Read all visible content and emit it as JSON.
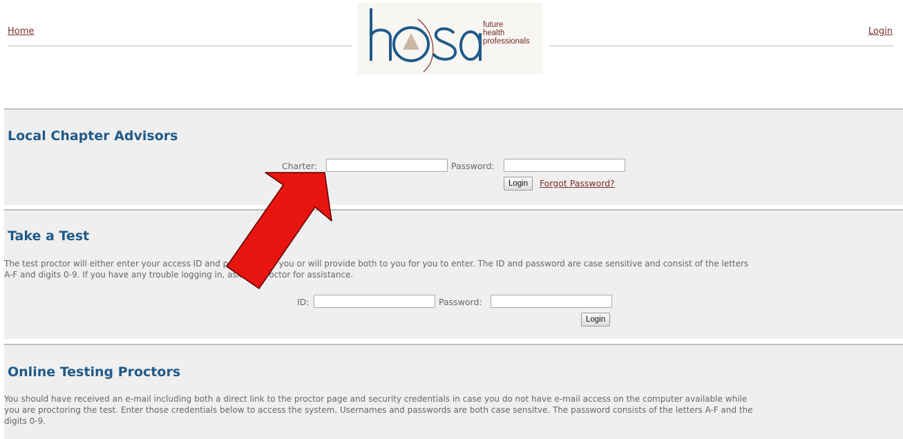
{
  "header": {
    "home_label": "Home",
    "login_label": "Login",
    "logo": {
      "wordmark": "hosa",
      "tagline": [
        "future",
        "health",
        "professionals"
      ],
      "colors": {
        "wordmark": "#1f5a8a",
        "tagline": "#7a2a2a",
        "triangle": "#c9b8a4"
      }
    }
  },
  "advisors": {
    "title": "Local Chapter Advisors",
    "charter_label": "Charter:",
    "charter_value": "",
    "password_label": "Password:",
    "password_value": "",
    "login_button": "Login",
    "forgot_link": "Forgot Password?"
  },
  "test": {
    "title": "Take a Test",
    "description_line1": "The test proctor will either enter your access ID and password for you or will provide both to you for you to enter. The ID and password are case sensitive and consist of the letters",
    "description_line2": "A-F and digits 0-9. If you have any trouble logging in, ask the proctor for assistance.",
    "id_label": "ID:",
    "id_value": "",
    "password_label": "Password:",
    "password_value": "",
    "login_button": "Login"
  },
  "proctors": {
    "title": "Online Testing Proctors",
    "description_line1": "You should have received an e-mail including both a direct link to the proctor page and security credentials in case you do not have e-mail access on the computer available while",
    "description_line2": "you are proctoring the test. Enter those credentials below to access the system. Usernames and passwords are both case sensitve. The password consists of the letters A-F and the",
    "description_line3": "digits 0-9."
  },
  "annotation": {
    "arrow_color": "#e8140f"
  }
}
